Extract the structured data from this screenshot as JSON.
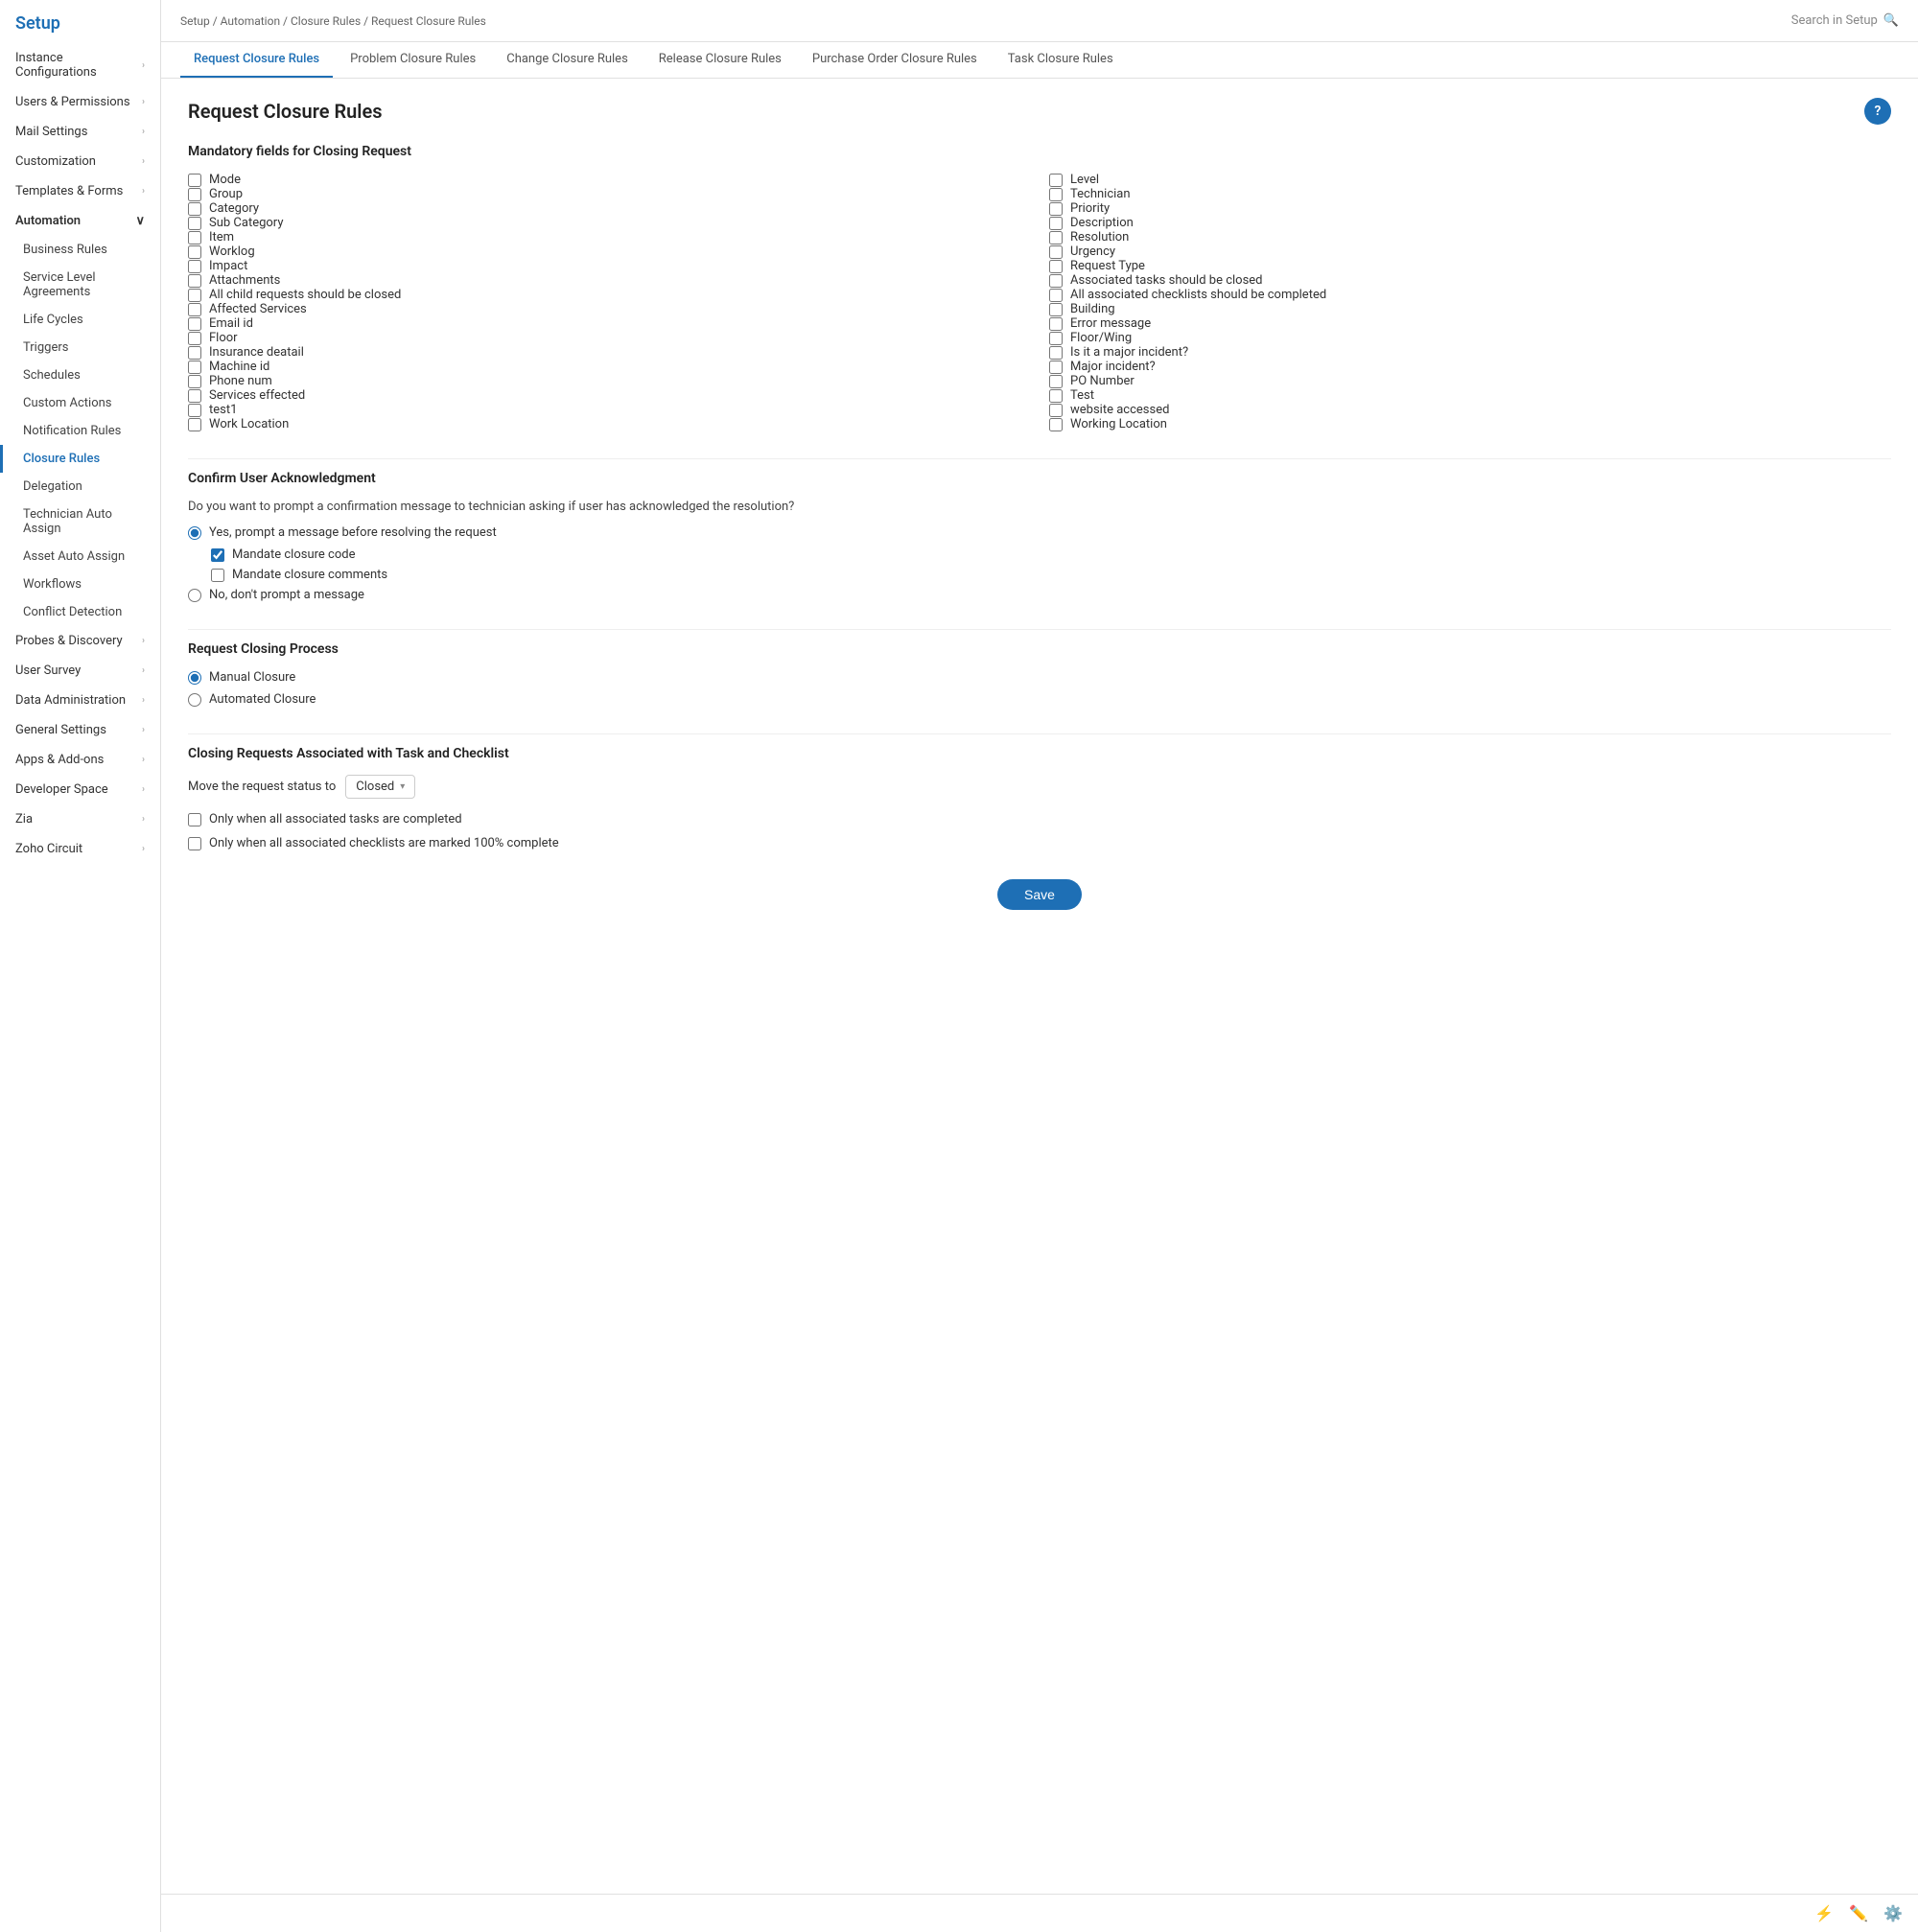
{
  "sidebar": {
    "title": "Setup",
    "items": [
      {
        "label": "Instance Configurations",
        "hasChildren": true
      },
      {
        "label": "Users & Permissions",
        "hasChildren": true
      },
      {
        "label": "Mail Settings",
        "hasChildren": true
      },
      {
        "label": "Customization",
        "hasChildren": true
      },
      {
        "label": "Templates & Forms",
        "hasChildren": true
      },
      {
        "label": "Automation",
        "hasChildren": true,
        "expanded": true
      },
      {
        "label": "Probes & Discovery",
        "hasChildren": true
      },
      {
        "label": "User Survey",
        "hasChildren": true
      },
      {
        "label": "Data Administration",
        "hasChildren": true
      },
      {
        "label": "General Settings",
        "hasChildren": true
      },
      {
        "label": "Apps & Add-ons",
        "hasChildren": true
      },
      {
        "label": "Developer Space",
        "hasChildren": true
      },
      {
        "label": "Zia",
        "hasChildren": true
      },
      {
        "label": "Zoho Circuit",
        "hasChildren": true
      }
    ],
    "automation_sub": [
      {
        "label": "Business Rules"
      },
      {
        "label": "Service Level Agreements"
      },
      {
        "label": "Life Cycles"
      },
      {
        "label": "Triggers"
      },
      {
        "label": "Schedules"
      },
      {
        "label": "Custom Actions"
      },
      {
        "label": "Notification Rules"
      },
      {
        "label": "Closure Rules",
        "active": true
      },
      {
        "label": "Delegation"
      },
      {
        "label": "Technician Auto Assign"
      },
      {
        "label": "Asset Auto Assign"
      },
      {
        "label": "Workflows"
      },
      {
        "label": "Conflict Detection"
      }
    ]
  },
  "topbar": {
    "breadcrumb": "Setup / Automation / Closure Rules / Request Closure Rules",
    "search_placeholder": "Search in Setup"
  },
  "tabs": [
    {
      "label": "Request Closure Rules",
      "active": true
    },
    {
      "label": "Problem Closure Rules"
    },
    {
      "label": "Change Closure Rules"
    },
    {
      "label": "Release Closure Rules"
    },
    {
      "label": "Purchase Order Closure Rules"
    },
    {
      "label": "Task Closure Rules"
    }
  ],
  "page": {
    "title": "Request Closure Rules",
    "help_label": "?"
  },
  "mandatory_section": {
    "title": "Mandatory fields for Closing Request",
    "fields_left": [
      {
        "label": "Mode",
        "checked": false
      },
      {
        "label": "Group",
        "checked": false
      },
      {
        "label": "Category",
        "checked": false
      },
      {
        "label": "Sub Category",
        "checked": false
      },
      {
        "label": "Item",
        "checked": false
      },
      {
        "label": "Worklog",
        "checked": false
      },
      {
        "label": "Impact",
        "checked": false
      },
      {
        "label": "Attachments",
        "checked": false
      },
      {
        "label": "All child requests should be closed",
        "checked": false
      },
      {
        "label": "Affected Services",
        "checked": false
      },
      {
        "label": "Email id",
        "checked": false
      },
      {
        "label": "Floor",
        "checked": false
      },
      {
        "label": "Insurance deatail",
        "checked": false
      },
      {
        "label": "Machine id",
        "checked": false
      },
      {
        "label": "Phone num",
        "checked": false
      },
      {
        "label": "Services effected",
        "checked": false
      },
      {
        "label": "test1",
        "checked": false
      },
      {
        "label": "Work Location",
        "checked": false
      }
    ],
    "fields_right": [
      {
        "label": "Level",
        "checked": false
      },
      {
        "label": "Technician",
        "checked": false
      },
      {
        "label": "Priority",
        "checked": false
      },
      {
        "label": "Description",
        "checked": false
      },
      {
        "label": "Resolution",
        "checked": false
      },
      {
        "label": "Urgency",
        "checked": false
      },
      {
        "label": "Request Type",
        "checked": false
      },
      {
        "label": "Associated tasks should be closed",
        "checked": false
      },
      {
        "label": "All associated checklists should be completed",
        "checked": false
      },
      {
        "label": "Building",
        "checked": false
      },
      {
        "label": "Error message",
        "checked": false
      },
      {
        "label": "Floor/Wing",
        "checked": false
      },
      {
        "label": "Is it a major incident?",
        "checked": false
      },
      {
        "label": "Major incident?",
        "checked": false
      },
      {
        "label": "PO Number",
        "checked": false
      },
      {
        "label": "Test",
        "checked": false
      },
      {
        "label": "website accessed",
        "checked": false
      },
      {
        "label": "Working Location",
        "checked": false
      }
    ]
  },
  "acknowledgment_section": {
    "title": "Confirm User Acknowledgment",
    "description": "Do you want to prompt a confirmation message to technician asking if user has acknowledged the resolution?",
    "option_yes": "Yes, prompt a message before resolving the request",
    "mandate_closure_code": "Mandate closure code",
    "mandate_closure_comments": "Mandate closure comments",
    "option_no": "No, don't prompt a message",
    "yes_selected": true,
    "mandate_code_checked": true,
    "mandate_comments_checked": false
  },
  "closing_process_section": {
    "title": "Request Closing Process",
    "manual": "Manual Closure",
    "automated": "Automated Closure",
    "manual_selected": true
  },
  "closing_task_section": {
    "title": "Closing Requests Associated with Task and Checklist",
    "move_label": "Move the request status to",
    "status_value": "Closed",
    "only_tasks_label": "Only when all associated tasks are completed",
    "only_checklists_label": "Only when all associated checklists are marked 100% complete"
  },
  "footer": {
    "save_label": "Save"
  },
  "bottom_icons": [
    "zia-icon",
    "edit-icon",
    "settings-icon"
  ]
}
